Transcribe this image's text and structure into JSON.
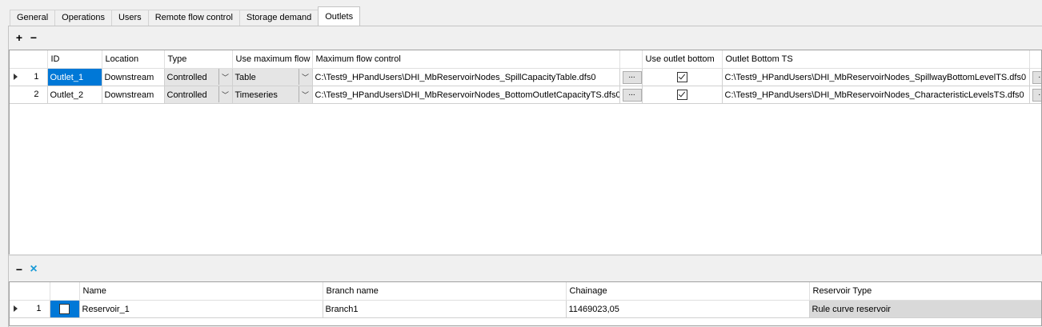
{
  "tabs": [
    "General",
    "Operations",
    "Users",
    "Remote flow control",
    "Storage demand",
    "Outlets"
  ],
  "active_tab": "Outlets",
  "outlets_toolbar": {
    "add": "+",
    "remove": "−"
  },
  "outlets_grid": {
    "columns": [
      "ID",
      "Location",
      "Type",
      "Use maximum flow",
      "Maximum flow control",
      "",
      "Use outlet bottom",
      "Outlet Bottom TS",
      ""
    ],
    "rows": [
      {
        "num": "1",
        "id": "Outlet_1",
        "location": "Downstream",
        "type": "Controlled",
        "use_max_flow": "Table",
        "max_flow_control": "C:\\Test9_HPandUsers\\DHI_MbReservoirNodes_SpillCapacityTable.dfs0",
        "ellipsis": "...",
        "use_outlet_bottom": true,
        "outlet_bottom_ts": "C:\\Test9_HPandUsers\\DHI_MbReservoirNodes_SpillwayBottomLevelTS.dfs0",
        "ellipsis2": "..."
      },
      {
        "num": "2",
        "id": "Outlet_2",
        "location": "Downstream",
        "type": "Controlled",
        "use_max_flow": "Timeseries",
        "max_flow_control": "C:\\Test9_HPandUsers\\DHI_MbReservoirNodes_BottomOutletCapacityTS.dfs0",
        "ellipsis": "...",
        "use_outlet_bottom": true,
        "outlet_bottom_ts": "C:\\Test9_HPandUsers\\DHI_MbReservoirNodes_CharacteristicLevelsTS.dfs0",
        "ellipsis2": "..."
      }
    ]
  },
  "reservoir_toolbar": {
    "remove": "−",
    "close": "×"
  },
  "reservoir_grid": {
    "columns": [
      "",
      "Name",
      "Branch name",
      "Chainage",
      "Reservoir Type"
    ],
    "rows": [
      {
        "num": "1",
        "checked": false,
        "name": "Reservoir_1",
        "branch": "Branch1",
        "chainage": "11469023,05",
        "reservoir_type": "Rule curve reservoir"
      }
    ]
  },
  "colors": {
    "selection": "#0078d7",
    "accent_close": "#1a9bd7"
  }
}
